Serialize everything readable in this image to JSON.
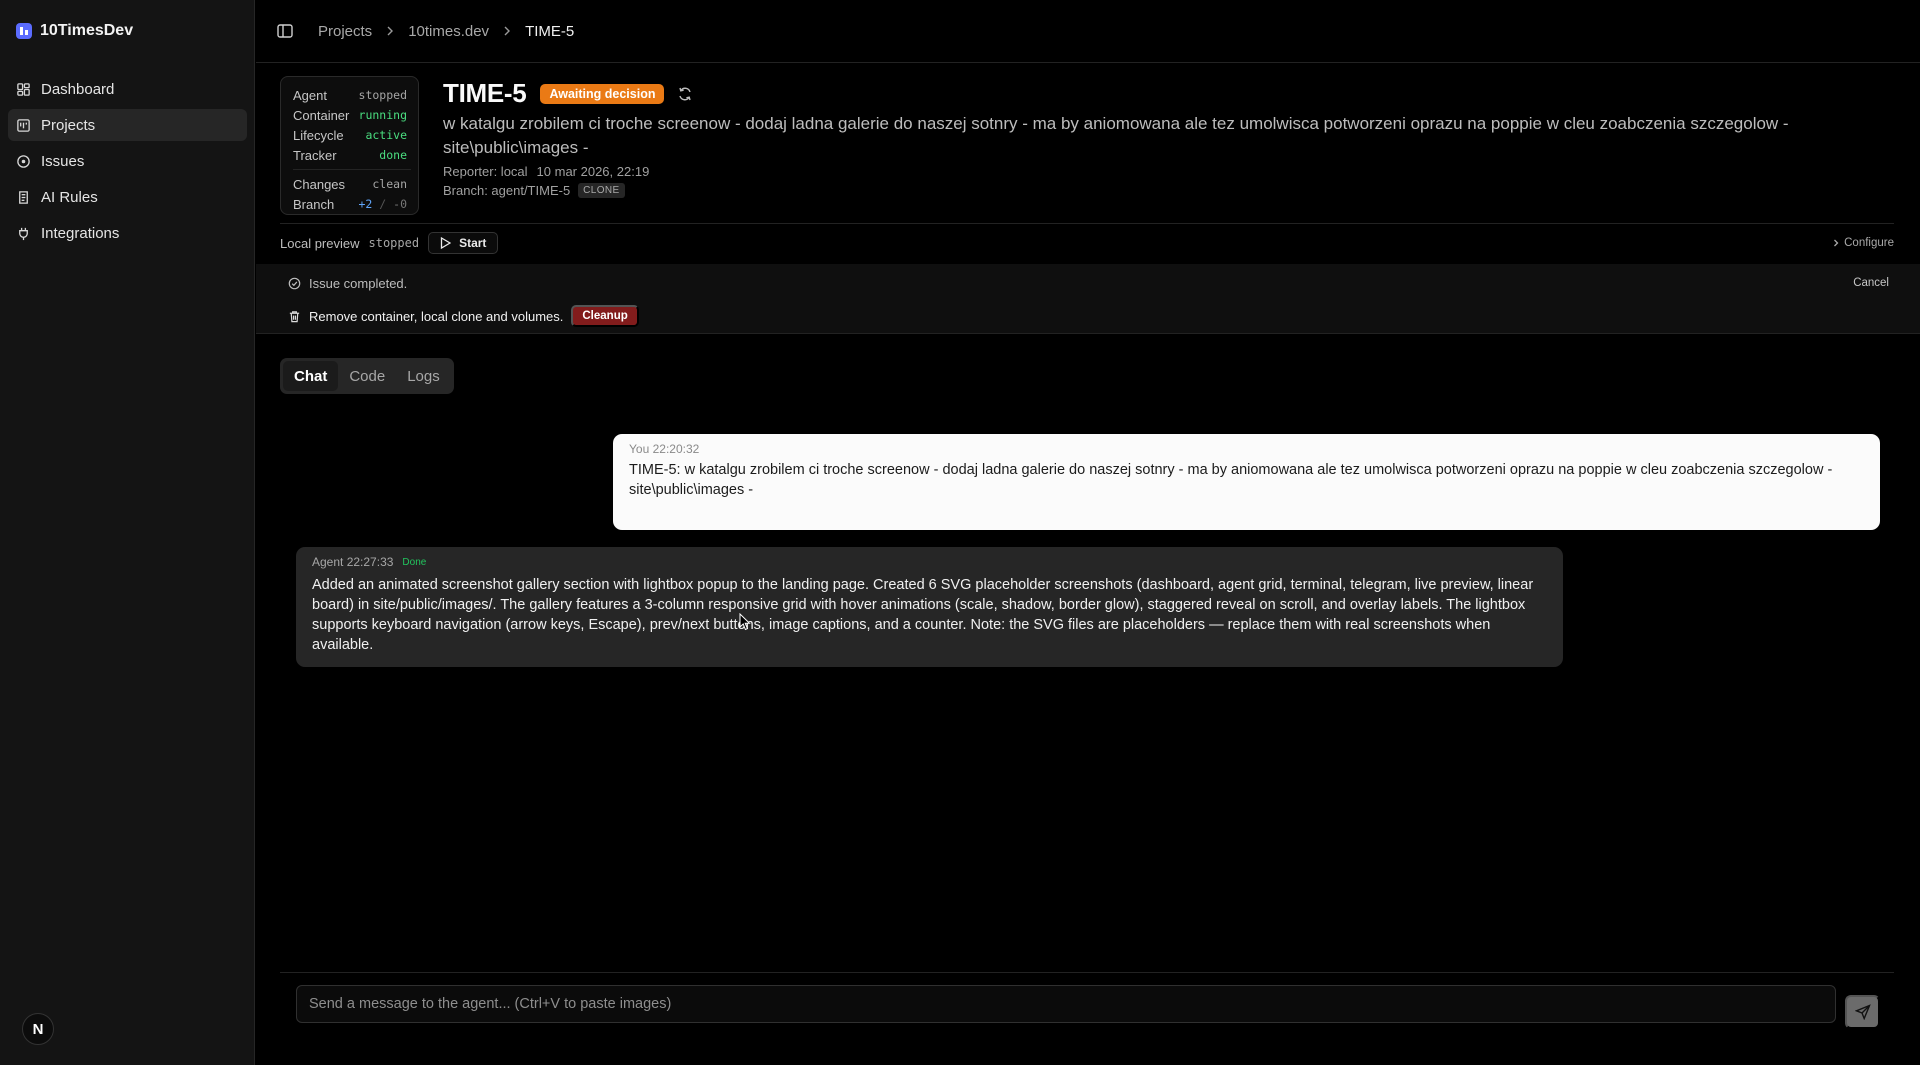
{
  "app": {
    "name": "10TimesDev",
    "user_initial": "N"
  },
  "sidebar": {
    "items": [
      {
        "label": "Dashboard",
        "icon": "dashboard-icon"
      },
      {
        "label": "Projects",
        "icon": "projects-icon",
        "active": true
      },
      {
        "label": "Issues",
        "icon": "issues-icon"
      },
      {
        "label": "AI Rules",
        "icon": "rules-icon"
      },
      {
        "label": "Integrations",
        "icon": "plug-icon"
      }
    ]
  },
  "breadcrumb": [
    "Projects",
    "10times.dev",
    "TIME-5"
  ],
  "status": {
    "agent": {
      "label": "Agent",
      "value": "stopped"
    },
    "container": {
      "label": "Container",
      "value": "running"
    },
    "lifecycle": {
      "label": "Lifecycle",
      "value": "active"
    },
    "tracker": {
      "label": "Tracker",
      "value": "done"
    },
    "changes": {
      "label": "Changes",
      "value": "clean"
    },
    "branch": {
      "label": "Branch",
      "added": "+2",
      "sep": "/",
      "removed": "-0"
    }
  },
  "issue": {
    "key": "TIME-5",
    "badge": "Awaiting decision",
    "description": "w katalgu zrobilem ci troche screenow - dodaj ladna galerie do naszej sotnry - ma by aniomowana ale tez umolwisca potworzeni oprazu na poppie w cleu zoabczenia szczegolow - site\\public\\images -",
    "reporter": "Reporter: local",
    "date": "10 mar 2026, 22:19",
    "branch": "Branch: agent/TIME-5",
    "clone_tag": "CLONE"
  },
  "preview": {
    "label": "Local preview",
    "state": "stopped",
    "start_label": "Start",
    "configure_label": "Configure"
  },
  "completion": {
    "message": "Issue completed.",
    "cancel_label": "Cancel",
    "cleanup_text": "Remove container, local clone and volumes.",
    "cleanup_label": "Cleanup"
  },
  "tabs": [
    {
      "label": "Chat",
      "active": true
    },
    {
      "label": "Code"
    },
    {
      "label": "Logs"
    }
  ],
  "messages": {
    "user": {
      "author": "You",
      "time": "22:20:32",
      "text": "TIME-5: w katalgu zrobilem ci troche screenow - dodaj ladna galerie do naszej sotnry - ma by aniomowana ale tez umolwisca potworzeni oprazu na poppie w cleu zoabczenia szczegolow -  site\\public\\images -"
    },
    "agent": {
      "author": "Agent",
      "time": "22:27:33",
      "status": "Done",
      "text": "Added an animated screenshot gallery section with lightbox popup to the landing page. Created 6 SVG placeholder screenshots (dashboard, agent grid, terminal, telegram, live preview, linear board) in site/public/images/. The gallery features a 3-column responsive grid with hover animations (scale, shadow, border glow), staggered reveal on scroll, and overlay labels. The lightbox supports keyboard navigation (arrow keys, Escape), prev/next buttons, image captions, and a counter. Note: the SVG files are placeholders — replace them with real screenshots when available."
    }
  },
  "composer": {
    "placeholder": "Send a message to the agent... (Ctrl+V to paste images)"
  },
  "colors": {
    "accent": "#5b6cff",
    "awaiting": "#ea7a15",
    "cleanup": "#821c1c",
    "green": "#4ade80"
  }
}
